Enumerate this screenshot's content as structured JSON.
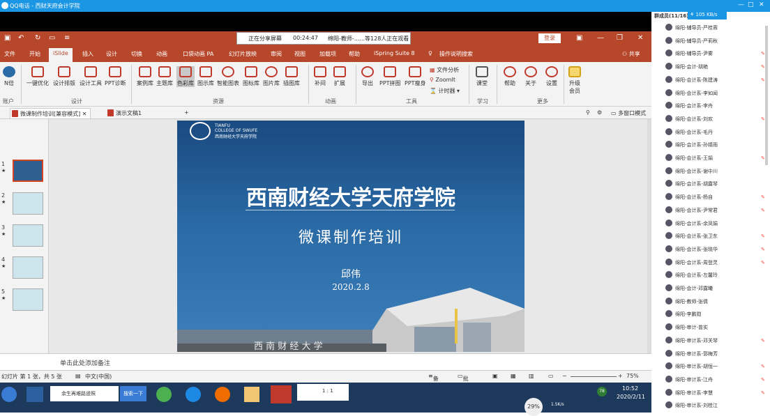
{
  "qq": {
    "title": "QQ电话 - 西财天府会计学院",
    "controls": [
      "—",
      "□",
      "✕"
    ]
  },
  "ppt": {
    "share_status": "正在分享屏幕",
    "share_time": "00:24:47",
    "share_viewers": "绵阳-教师-......等128人正在观看",
    "login_label": "登录",
    "menu": [
      "文件",
      "开始",
      "iSlide",
      "插入",
      "设计",
      "切换",
      "动画",
      "口袋动画 PA",
      "幻灯片放映",
      "审阅",
      "视图",
      "加载项",
      "帮助",
      "iSpring Suite 8",
      "操作说明搜索",
      "共享"
    ],
    "ribbon": {
      "account": {
        "label": "N倍",
        "group": "账户"
      },
      "design_buttons": [
        "一键优化",
        "设计排版",
        "设计工具",
        "PPT诊断"
      ],
      "design_group": "设计",
      "resource_buttons": [
        "案例库",
        "主题库",
        "色彩库",
        "图示库",
        "智能图表",
        "图标库",
        "图片库",
        "插图库"
      ],
      "resource_group": "资源",
      "anim_buttons": [
        "补间",
        "扩展"
      ],
      "anim_group": "动画",
      "tool_buttons": [
        "导出",
        "PPT拼图",
        "PPT瘦身"
      ],
      "tool_small": [
        "文件分析",
        "ZoomIt",
        "计时器"
      ],
      "tool_group": "工具",
      "learn_button": "课堂",
      "learn_group": "学习",
      "more_buttons": [
        "帮助",
        "关于",
        "设置"
      ],
      "more_group": "更多",
      "upgrade": [
        "升级",
        "会员"
      ]
    },
    "tabs": [
      "微课制作培训[兼容模式]",
      "演示文稿1"
    ],
    "multi_window": "多窗口模式",
    "slides": [
      "1",
      "2",
      "3",
      "4",
      "5"
    ],
    "slide": {
      "logo_en1": "TIANFU",
      "logo_en2": "COLLEGE OF SWUFE",
      "logo_cn": "西南财经大学天府学院",
      "title": "西南财经大学天府学院",
      "subtitle": "微课制作培训",
      "author": "邱伟",
      "date": "2020.2.8",
      "gate_text": "西 南 财 经 大 学"
    },
    "notes": "单击此处添加备注",
    "status": {
      "slide_info": "幻灯片 第 1 张，共 5 张",
      "lang": "中文(中国)",
      "notes_btn": "备注",
      "comments_btn": "批注",
      "zoom": "75%"
    }
  },
  "taskbar": {
    "items": [
      "余生再难路遥照",
      "搜索一下"
    ],
    "time": "10:52",
    "date": "2020/2/11",
    "speed_pct": "29%",
    "speed": "1.5K/s",
    "ratio": "1 : 1",
    "badge": "78"
  },
  "side": {
    "header": "群成员(11/16)",
    "net": "105 KB/s",
    "members": [
      "绵阳-辅导员-严桂蓉",
      "绵阳-辅导员-严莉秋",
      "绵阳-辅导员-尹雾",
      "绵阳-会计-胡艳",
      "绵阳-会计系-陈建涛",
      "绵阳-会计系-李如闻",
      "绵阳-会计系-李舟",
      "绵阳-会计系-刘欢",
      "绵阳-会计系-毛丹",
      "绵阳-会计系-孙婧雨",
      "绵阳-会计系-王娟",
      "绵阳-会计系-谢中川",
      "绵阳-会计系-胡露琴",
      "绵阳-会计系-杨自",
      "绵阳-会计系-尹常君",
      "绵阳-会计系-余凤娟",
      "绵阳-会计系-张卫东",
      "绵阳-会计系-张晓华",
      "绵阳-会计系-周登灵",
      "绵阳-会计系-左馨玲",
      "绵阳-会计-邓露曦",
      "绵阳-教师-张倩",
      "绵阳-李鹏勋",
      "绵阳-审计-曾实",
      "绵阳-审计系-邓关琴",
      "绵阳-审计系-郭梅芳",
      "绵阳-审计系-胡恒一",
      "绵阳-审计系-江舟",
      "绵阳-审计系-李慧",
      "绵阳-审计系-刘桂江"
    ]
  }
}
